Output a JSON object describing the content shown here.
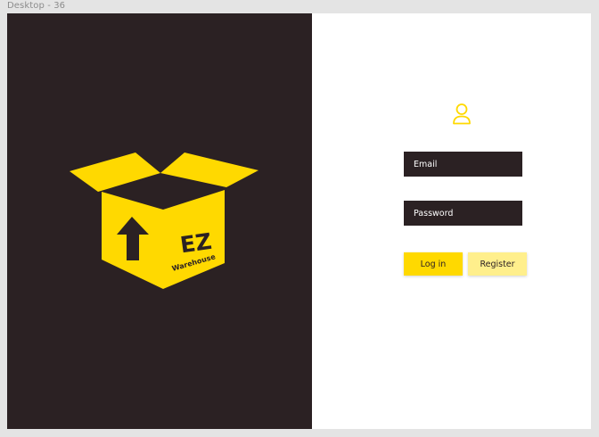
{
  "frame": {
    "title": "Desktop - 36"
  },
  "brand": {
    "logo_icon": "box-icon",
    "logo_title": "EZ",
    "logo_subtitle": "Warehouse"
  },
  "login": {
    "user_icon": "user-icon",
    "email_placeholder": "Email",
    "password_placeholder": "Password",
    "login_label": "Log in",
    "register_label": "Register"
  },
  "colors": {
    "dark": "#2b2123",
    "accent": "#ffd900",
    "accent_light": "#ffef8c",
    "background": "#ffffff"
  }
}
